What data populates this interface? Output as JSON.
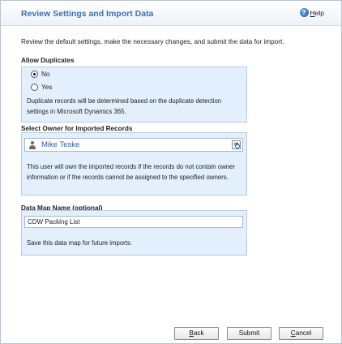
{
  "dialog": {
    "title": "Review Settings and Import Data",
    "help_label": "Help",
    "intro": "Review the default settings, make the necessary changes, and submit the data for import."
  },
  "duplicates": {
    "label": "Allow Duplicates",
    "options": [
      {
        "label": "No",
        "selected": true
      },
      {
        "label": "Yes",
        "selected": false
      }
    ],
    "note": "Duplicate records will be determined based on the duplicate detection settings in Microsoft Dynamics 365."
  },
  "owner": {
    "label": "Select Owner for Imported Records",
    "value": "Mike Teske",
    "note": "This user will own the imported records if the records do not contain owner information or if the records cannot be assigned to the specified owners."
  },
  "datamap": {
    "label": "Data Map Name (optional)",
    "value": "CDW Packing List",
    "note": "Save this data map for future imports."
  },
  "buttons": {
    "back": {
      "first": "B",
      "rest": "ack"
    },
    "submit": "Submit",
    "cancel": {
      "first": "C",
      "rest": "ancel"
    }
  },
  "colors": {
    "title": "#3e6fb0",
    "panel_bg": "#e3effd",
    "panel_border": "#b8cce4",
    "lookup_text": "#2a5ea8"
  },
  "icons": {
    "help": "help-icon",
    "user": "user-icon",
    "lookup": "lookup-icon"
  }
}
